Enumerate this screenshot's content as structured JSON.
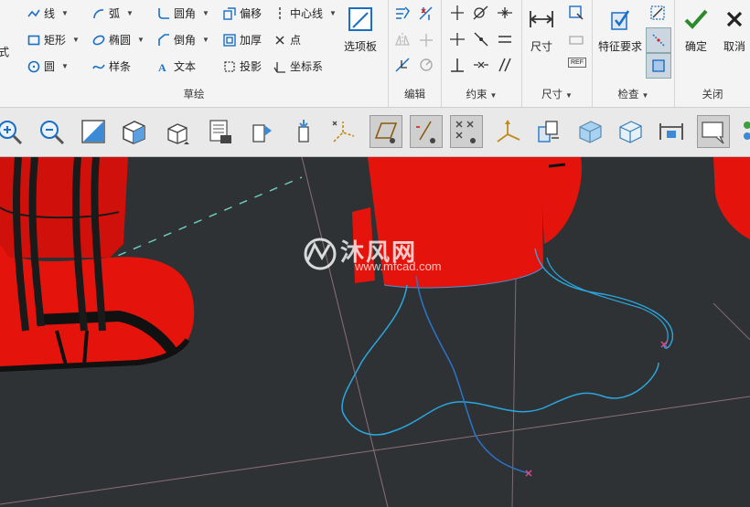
{
  "ribbon": {
    "sketch": {
      "left_partial": "式",
      "items": [
        "线",
        "弧",
        "圆角",
        "偏移",
        "中心线",
        "矩形",
        "椭圆",
        "倒角",
        "加厚",
        "点",
        "圆",
        "样条",
        "文本",
        "投影",
        "坐标系"
      ],
      "palette_label": "选项板",
      "group_label": "草绘"
    },
    "edit": {
      "group_label": "编辑"
    },
    "constrain": {
      "group_label": "约束"
    },
    "dimension": {
      "button_label": "尺寸",
      "group_label": "尺寸",
      "ref_tag": "REF"
    },
    "inspect": {
      "button_label": "特征要求",
      "group_label": "检查"
    },
    "close": {
      "ok_label": "确定",
      "cancel_label": "取消",
      "group_label": "关闭"
    }
  },
  "toolbar": {
    "buttons": [
      "zoom-in",
      "zoom-out",
      "refit",
      "repaint",
      "view-orientation",
      "saved-views",
      "view-manager",
      "named-views",
      "datum-display",
      "sketch-view",
      "disp-dims",
      "disp-constraints",
      "disp-grid",
      "disp-vertices",
      "spin-center",
      "shading",
      "hidden-line",
      "section",
      "annotation",
      "appearance"
    ]
  },
  "viewport": {
    "watermark_cn": "沐风网",
    "watermark_url": "www.mfcad.com",
    "colors": {
      "background": "#2f3235",
      "model": "#e4140c",
      "spline": "#2aa7df",
      "accent": "#2b8a2b"
    }
  }
}
